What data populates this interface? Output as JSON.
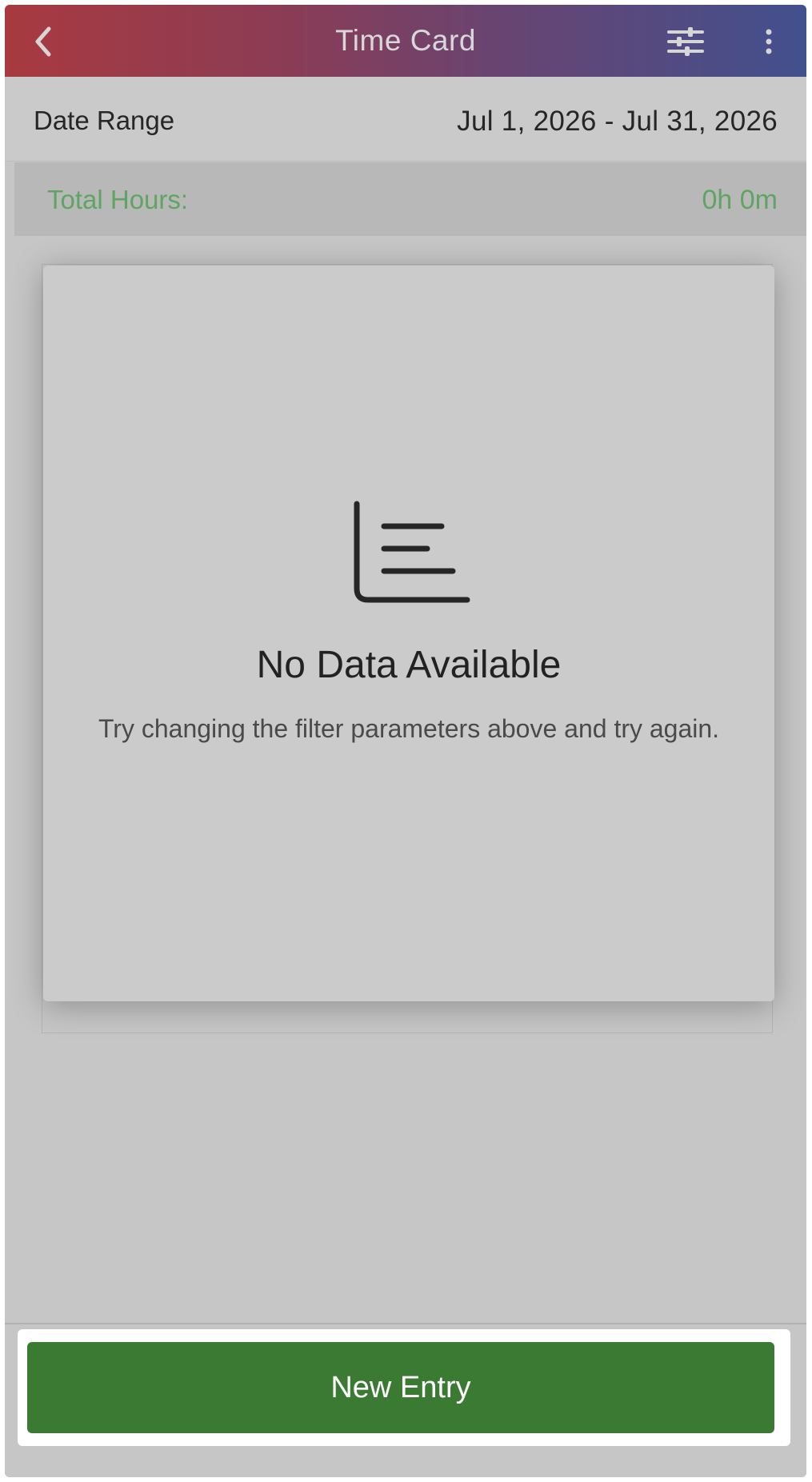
{
  "appbar": {
    "title": "Time Card",
    "back_icon": "chevron-left-icon",
    "filter_icon": "sliders-icon",
    "more_icon": "more-vertical-icon"
  },
  "date_range": {
    "label": "Date Range",
    "value": "Jul 1, 2026 - Jul 31, 2026"
  },
  "total_hours": {
    "label": "Total Hours:",
    "value": "0h 0m",
    "color": "#5fa562"
  },
  "empty_state": {
    "icon": "bar-chart-icon",
    "title": "No Data Available",
    "subtitle": "Try changing the filter parameters above and try again."
  },
  "footer": {
    "new_entry_label": "New Entry",
    "button_color": "#3b7a33"
  },
  "colors": {
    "header_start": "#a83a40",
    "header_end": "#42508e"
  }
}
